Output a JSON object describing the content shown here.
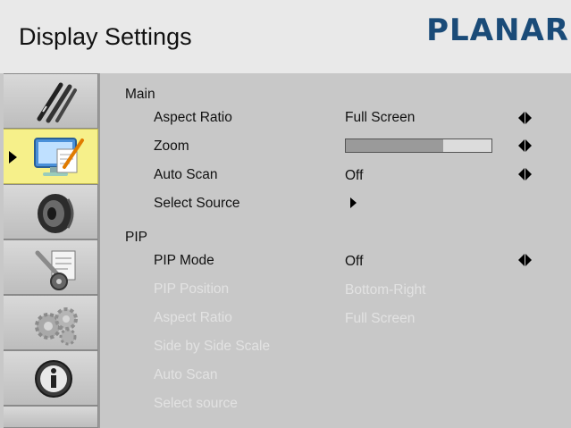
{
  "header": {
    "title": "Display Settings",
    "brand": "PLANAR",
    "brand_color": "#1a4b78"
  },
  "sidebar": {
    "tabs": [
      {
        "name": "tools",
        "icon": "pens-icon",
        "active": false
      },
      {
        "name": "display",
        "icon": "monitor-icon",
        "active": true
      },
      {
        "name": "audio",
        "icon": "speaker-icon",
        "active": false
      },
      {
        "name": "setup",
        "icon": "wrench-gear-icon",
        "active": false
      },
      {
        "name": "advanced",
        "icon": "gears-icon",
        "active": false
      },
      {
        "name": "info",
        "icon": "info-icon",
        "active": false
      }
    ],
    "active_color": "#f6f08a"
  },
  "main": {
    "section_main": "Main",
    "aspect_ratio": {
      "label": "Aspect Ratio",
      "value": "Full Screen"
    },
    "zoom": {
      "label": "Zoom",
      "level": 0.67
    },
    "auto_scan": {
      "label": "Auto Scan",
      "value": "Off"
    },
    "select_source": {
      "label": "Select Source"
    },
    "section_pip": "PIP",
    "pip_mode": {
      "label": "PIP Mode",
      "value": "Off"
    },
    "pip_position": {
      "label": "PIP Position",
      "value": "Bottom-Right"
    },
    "pip_aspect_ratio": {
      "label": "Aspect Ratio",
      "value": "Full Screen"
    },
    "side_by_side": {
      "label": "Side by Side Scale"
    },
    "pip_auto_scan": {
      "label": "Auto Scan"
    },
    "pip_select_source": {
      "label": "Select source"
    }
  }
}
